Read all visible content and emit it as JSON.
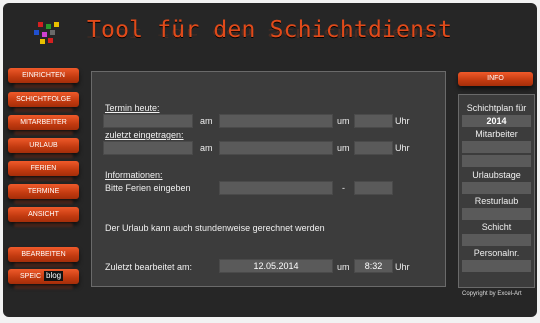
{
  "app": {
    "title": "Tool für den Schichtdienst"
  },
  "logo": {
    "colors": [
      "#d42020",
      "#2a9a2a",
      "#e8c000",
      "#2050d0",
      "#d040d0",
      "#6a6a6a"
    ]
  },
  "nav": {
    "items": [
      {
        "label": "EINRICHTEN"
      },
      {
        "label": "SCHICHTFOLGE"
      },
      {
        "label": "MITARBEITER"
      },
      {
        "label": "URLAUB"
      },
      {
        "label": "FERIEN"
      },
      {
        "label": "TERMINE"
      },
      {
        "label": "ANSICHT"
      },
      {
        "label": "BEARBEITEN"
      },
      {
        "label": "SPEIC"
      }
    ],
    "overlay_badge": "blog"
  },
  "main": {
    "termin_heute_label": "Termin heute:",
    "zuletzt_eingetragen_label": "zuletzt eingetragen:",
    "am_label": "am",
    "um_label": "um",
    "uhr_label": "Uhr",
    "informationen_label": "Informationen:",
    "ferien_label": "Bitte Ferien eingeben",
    "dash": "-",
    "urlaub_note": "Der Urlaub kann auch stundenweise gerechnet werden",
    "zuletzt_bearbeitet_label": "Zuletzt bearbeitet am:",
    "last_edit_date": "12.05.2014",
    "last_edit_time": "8:32"
  },
  "info_button": {
    "label": "INFO"
  },
  "side": {
    "schichtplan_label": "Schichtplan für",
    "year": "2014",
    "mitarbeiter_label": "Mitarbeiter",
    "urlaubstage_label": "Urlaubstage",
    "resturlaub_label": "Resturlaub",
    "schicht_label": "Schicht",
    "personalnr_label": "Personalnr."
  },
  "footer": {
    "copyright": "Copyright by Excel-Art"
  }
}
